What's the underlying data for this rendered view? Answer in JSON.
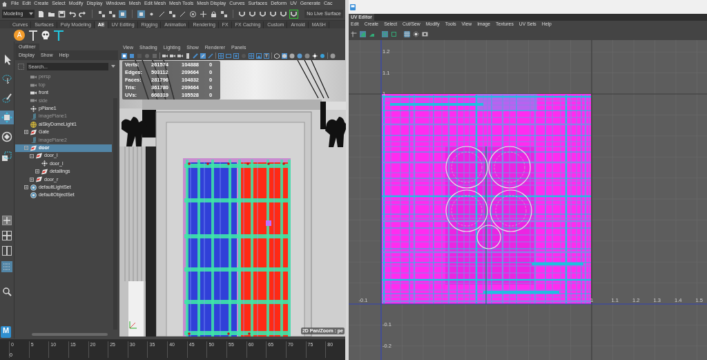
{
  "main_window": {
    "menu_bar": [
      "File",
      "Edit",
      "Create",
      "Select",
      "Modify",
      "Display",
      "Windows",
      "Mesh",
      "Edit Mesh",
      "Mesh Tools",
      "Mesh Display",
      "Curves",
      "Surfaces",
      "Deform",
      "UV",
      "Generate",
      "Cac"
    ],
    "toolbar": {
      "mode": "Modeling",
      "live_surface": "No Live Surface"
    },
    "shelf_tabs": [
      {
        "label": "Curves",
        "selected": false
      },
      {
        "label": "Surfaces",
        "selected": false
      },
      {
        "label": "Poly Modeling",
        "selected": false
      },
      {
        "label": "AE",
        "selected": true
      },
      {
        "label": "UV Editing",
        "selected": false
      },
      {
        "label": "Rigging",
        "selected": false
      },
      {
        "label": "Animation",
        "selected": false
      },
      {
        "label": "Rendering",
        "selected": false
      },
      {
        "label": "FX",
        "selected": false
      },
      {
        "label": "FX Caching",
        "selected": false
      },
      {
        "label": "Custom",
        "selected": false
      },
      {
        "label": "Arnold",
        "selected": false
      },
      {
        "label": "MASH",
        "selected": false
      }
    ],
    "shelf_buttons": [
      {
        "kind": "badge",
        "label": "A"
      },
      {
        "kind": "joint"
      },
      {
        "kind": "skull"
      },
      {
        "kind": "joint_cyan"
      }
    ],
    "outliner": {
      "title": "Outliner",
      "menu": [
        "Display",
        "Show",
        "Help"
      ],
      "search": {
        "placeholder": "Search..."
      },
      "items": [
        {
          "label": "persp",
          "kind": "camera",
          "hidden": true,
          "selected": false
        },
        {
          "label": "top",
          "kind": "camera",
          "hidden": true,
          "selected": false
        },
        {
          "label": "front",
          "kind": "camera",
          "hidden": false,
          "selected": false
        },
        {
          "label": "side",
          "kind": "camera",
          "hidden": true,
          "selected": false
        },
        {
          "label": "pPlane1",
          "kind": "transform",
          "hidden": false,
          "selected": false
        },
        {
          "label": "imagePlane1",
          "kind": "image_plane",
          "hidden": true,
          "selected": false
        },
        {
          "label": "aiSkyDomeLight1",
          "kind": "sky_light",
          "hidden": false,
          "selected": false
        },
        {
          "label": "Gate",
          "kind": "group",
          "hidden": false,
          "expanded": false,
          "selected": false
        },
        {
          "label": "imagePlane2",
          "kind": "image_plane",
          "hidden": true,
          "selected": false
        },
        {
          "label": "door",
          "kind": "group",
          "hidden": false,
          "expanded": true,
          "selected": true,
          "children": [
            {
              "label": "door_l",
              "kind": "group",
              "hidden": false,
              "expanded": true,
              "selected": false,
              "children": [
                {
                  "label": "door_l",
                  "kind": "transform",
                  "hidden": false,
                  "selected": false
                },
                {
                  "label": "detailings",
                  "kind": "group",
                  "hidden": false,
                  "expanded": false,
                  "selected": false
                }
              ]
            },
            {
              "label": "door_r",
              "kind": "group",
              "hidden": false,
              "expanded": false,
              "selected": false
            }
          ]
        },
        {
          "label": "defaultLightSet",
          "kind": "set",
          "hidden": false,
          "expanded": false,
          "selected": false
        },
        {
          "label": "defaultObjectSet",
          "kind": "set",
          "hidden": false,
          "selected": false
        }
      ]
    },
    "viewport": {
      "menu": [
        "View",
        "Shading",
        "Lighting",
        "Show",
        "Renderer",
        "Panels"
      ],
      "stats": [
        {
          "label": "Verts:",
          "values": [
            "261574",
            "104888",
            "0"
          ]
        },
        {
          "label": "Edges:",
          "values": [
            "503112",
            "209664",
            "0"
          ]
        },
        {
          "label": "Faces:",
          "values": [
            "281796",
            "104832",
            "0"
          ]
        },
        {
          "label": "Tris:",
          "values": [
            "361780",
            "209664",
            "0"
          ]
        },
        {
          "label": "UVs:",
          "values": [
            "668319",
            "105528",
            "0"
          ]
        }
      ],
      "status": "2D Pan/Zoom : pe"
    },
    "logo": "M",
    "timeline": {
      "ticks": [
        "0",
        "5",
        "10",
        "15",
        "20",
        "25",
        "30",
        "35",
        "40",
        "45",
        "50",
        "55",
        "60",
        "65",
        "70",
        "75",
        "80"
      ],
      "current_frame": "0"
    }
  },
  "uv_editor": {
    "tab": "UV Editor",
    "menu": [
      "Edit",
      "Create",
      "Select",
      "Cut/Sew",
      "Modify",
      "Tools",
      "View",
      "Image",
      "Textures",
      "UV Sets",
      "Help"
    ],
    "u_labels": [
      "-0.1",
      "1",
      "1.1",
      "1.2",
      "1.3",
      "1.4",
      "1.5"
    ],
    "v_labels": [
      "1.2",
      "1.1",
      "1",
      "-0.1",
      "-0.2"
    ]
  }
}
